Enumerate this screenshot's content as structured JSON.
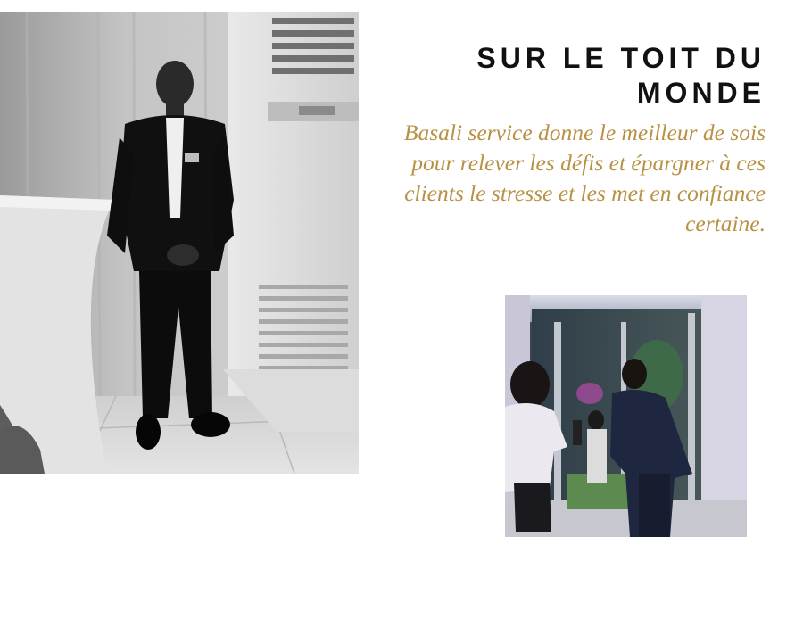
{
  "page": {
    "title": "SUR LE TOIT DU MONDE",
    "description": "Basali service donne le meilleur de sois pour relever les défis et épargner à ces clients le stresse et les met en confiance certaine.",
    "colors": {
      "title": "#111111",
      "description": "#b89144",
      "background": "#ffffff"
    }
  },
  "images": {
    "main_photo": "photo of a man in a black suit standing beside an air-conditioning unit",
    "secondary_photo": "photo of two staff members at a glass doorway"
  }
}
